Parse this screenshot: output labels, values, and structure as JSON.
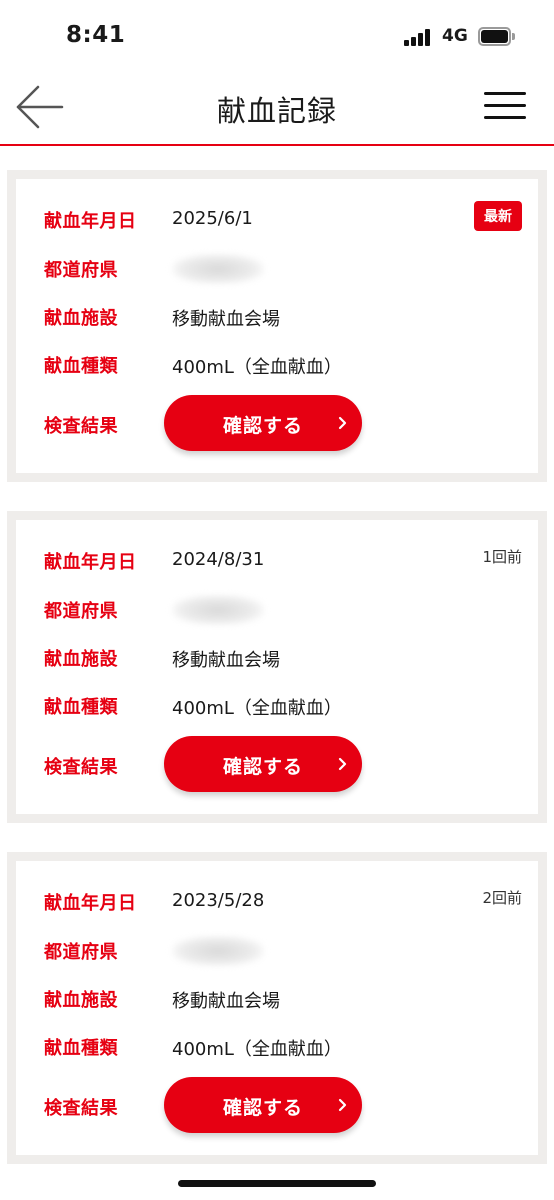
{
  "status_bar": {
    "time": "8:41",
    "network": "4G"
  },
  "header": {
    "title": "献血記録"
  },
  "labels": {
    "date": "献血年月日",
    "prefecture": "都道府県",
    "facility": "献血施設",
    "type": "献血種類",
    "result": "検査結果",
    "confirm_button": "確認する"
  },
  "records": [
    {
      "date": "2025/6/1",
      "badge": "最新",
      "facility": "移動献血会場",
      "type": "400mL（全血献血）"
    },
    {
      "date": "2024/8/31",
      "badge": "1回前",
      "facility": "移動献血会場",
      "type": "400mL（全血献血）"
    },
    {
      "date": "2023/5/28",
      "badge": "2回前",
      "facility": "移動献血会場",
      "type": "400mL（全血献血）"
    }
  ],
  "colors": {
    "accent": "#e60012",
    "card_border": "#efedeb"
  },
  "icons": {
    "back": "arrow-left-icon",
    "menu": "hamburger-menu-icon",
    "chevron": "chevron-right-icon"
  }
}
